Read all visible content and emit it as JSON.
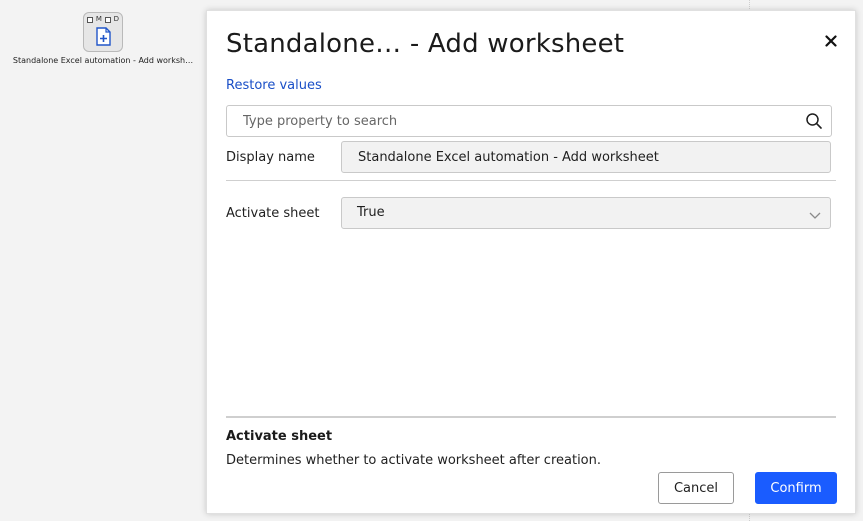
{
  "canvas": {
    "node": {
      "flags": [
        "M",
        "D"
      ],
      "caption": "Standalone Excel automation - Add worksh…",
      "icon": "add-document-icon"
    }
  },
  "dialog": {
    "title": "Standalone… - Add worksheet",
    "close_icon": "close-icon",
    "restore_label": "Restore values",
    "search": {
      "placeholder": "Type property to search",
      "value": "",
      "icon": "search-icon"
    },
    "display_name": {
      "label": "Display name",
      "value": "Standalone Excel automation - Add worksheet"
    },
    "activate_sheet": {
      "label": "Activate sheet",
      "value": "True",
      "icon": "chevron-down-icon"
    },
    "help": {
      "title": "Activate sheet",
      "text": "Determines whether to activate worksheet after creation."
    },
    "buttons": {
      "cancel": "Cancel",
      "confirm": "Confirm"
    }
  },
  "colors": {
    "link": "#1a4fc7",
    "primary": "#1a5cff",
    "background": "#f3f3f3",
    "panel": "#ffffff"
  }
}
